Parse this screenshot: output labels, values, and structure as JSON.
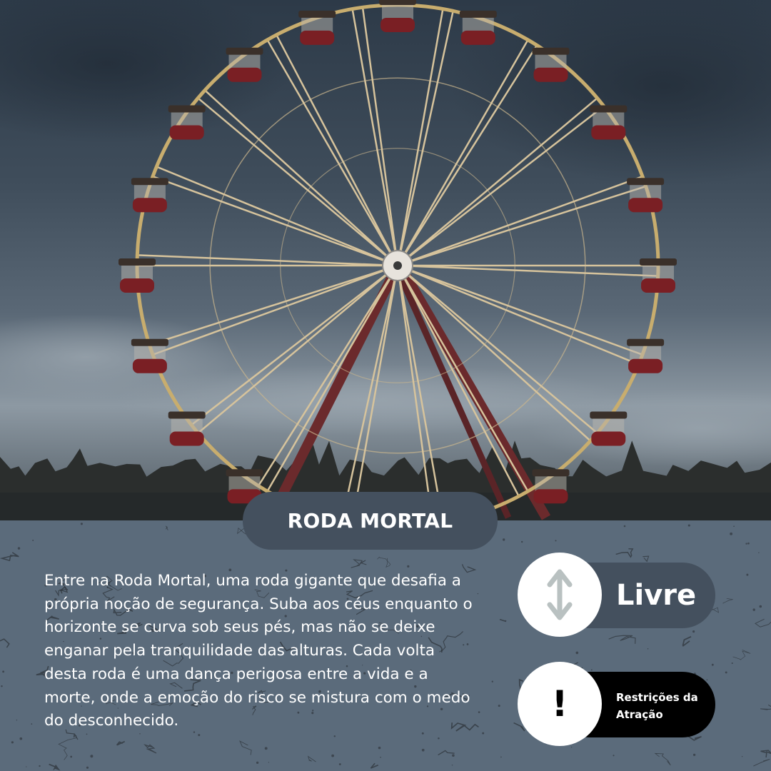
{
  "attraction": {
    "title": "RODA MORTAL",
    "description": "Entre na Roda Mortal, uma roda gigante que desafia a própria noção de segurança. Suba aos céus enquanto o horizonte se curva sob seus pés, mas não se deixe enganar pela tranquilidade das alturas. Cada volta desta roda é uma dança perigosa entre a vida e a morte, onde a emoção do risco se mistura com o medo do desconhecido."
  },
  "badges": {
    "height": {
      "label": "Livre",
      "icon": "up-down-arrow-icon"
    },
    "restrictions": {
      "label": "Restrições da Atração",
      "icon": "exclamation-icon"
    }
  },
  "colors": {
    "panel": "#5b6b7b",
    "pill": "#44505e",
    "restrictions_bar": "#000000",
    "arrow_icon": "#b9c1c1"
  }
}
